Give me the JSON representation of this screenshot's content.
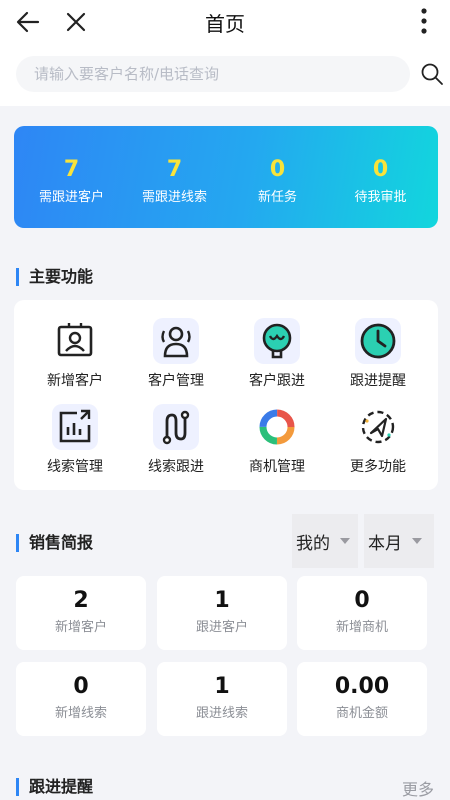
{
  "header": {
    "title": "首页"
  },
  "search": {
    "placeholder": "请输入要客户名称/电话查询"
  },
  "stats": [
    {
      "value": "7",
      "label": "需跟进客户"
    },
    {
      "value": "7",
      "label": "需跟进线索"
    },
    {
      "value": "0",
      "label": "新任务"
    },
    {
      "value": "0",
      "label": "待我审批"
    }
  ],
  "functions": {
    "title": "主要功能",
    "items": [
      {
        "label": "新增客户",
        "icon": "add-customer-icon"
      },
      {
        "label": "客户管理",
        "icon": "customer-management-icon"
      },
      {
        "label": "客户跟进",
        "icon": "customer-followup-icon"
      },
      {
        "label": "跟进提醒",
        "icon": "clock-icon"
      },
      {
        "label": "线索管理",
        "icon": "lead-management-icon"
      },
      {
        "label": "线索跟进",
        "icon": "lead-followup-icon"
      },
      {
        "label": "商机管理",
        "icon": "opportunity-icon"
      },
      {
        "label": "更多功能",
        "icon": "more-functions-icon"
      }
    ]
  },
  "sales": {
    "title": "销售简报",
    "scope_select": "我的",
    "period_select": "本月",
    "kpis": [
      {
        "value": "2",
        "label": "新增客户"
      },
      {
        "value": "1",
        "label": "跟进客户"
      },
      {
        "value": "0",
        "label": "新增商机"
      },
      {
        "value": "0",
        "label": "新增线索"
      },
      {
        "value": "1",
        "label": "跟进线索"
      },
      {
        "value": "0.00",
        "label": "商机金额"
      }
    ]
  },
  "reminders": {
    "title": "跟进提醒",
    "more_label": "更多"
  },
  "colors": {
    "accent": "#2d86f5",
    "stat_number": "#f9e33a",
    "banner_start": "#2e86f5",
    "banner_end": "#12d6dd"
  }
}
